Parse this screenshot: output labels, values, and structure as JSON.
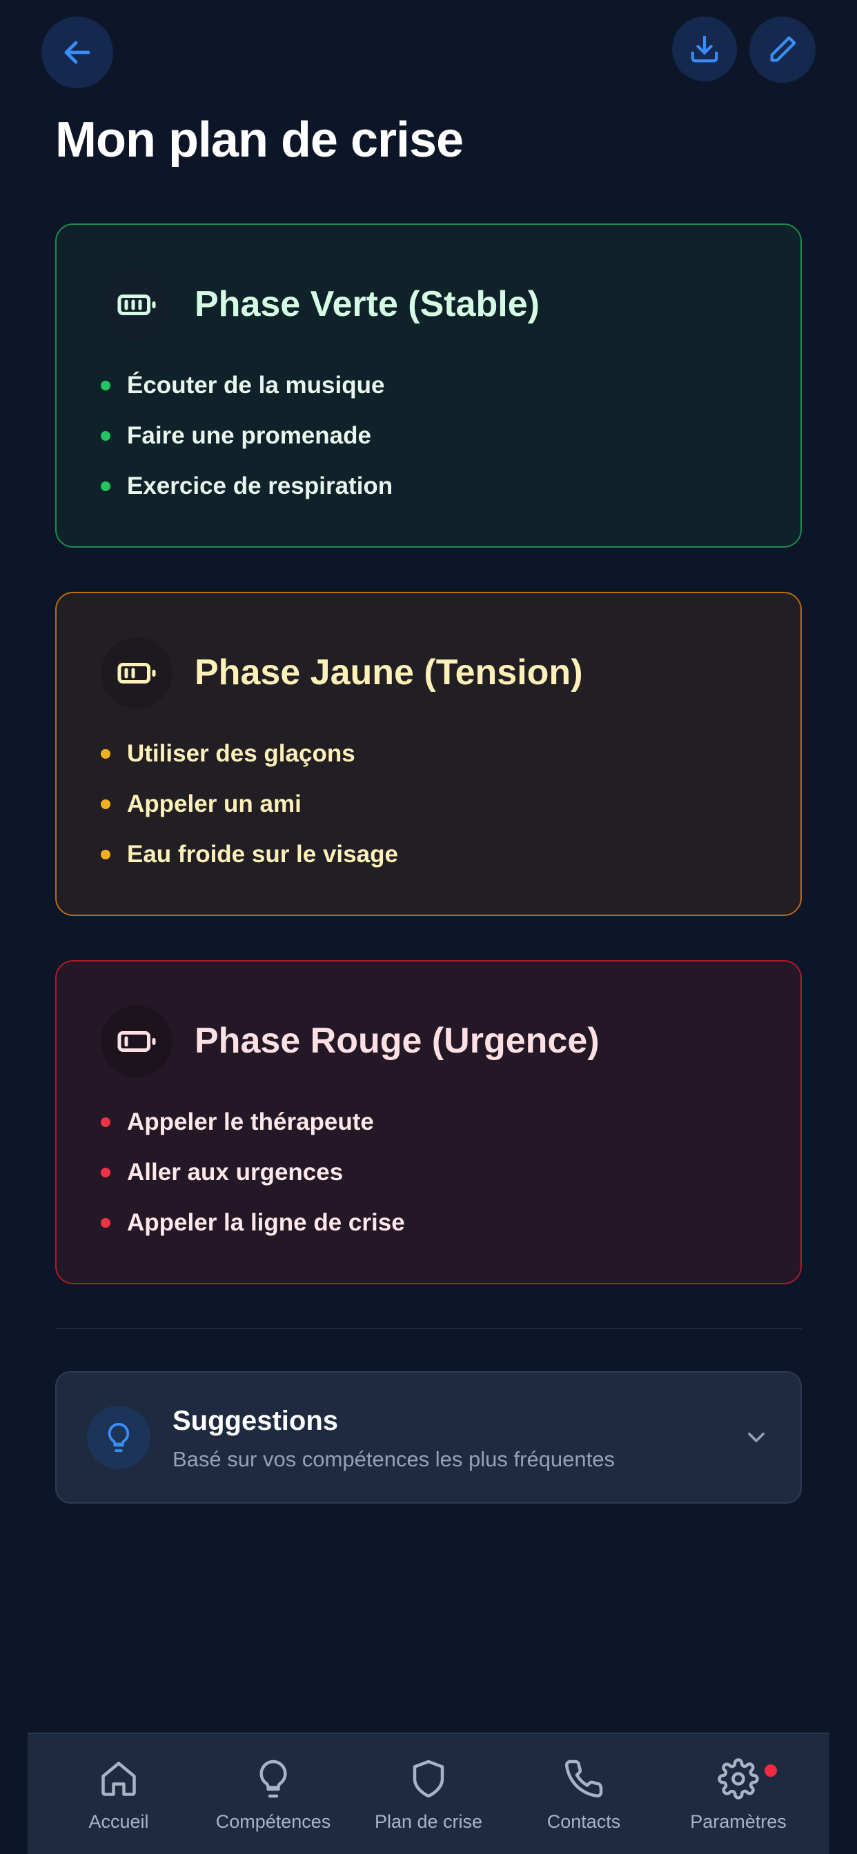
{
  "header": {
    "title": "Mon plan de crise"
  },
  "phases": [
    {
      "title": "Phase Verte (Stable)",
      "icon": "battery-full-icon",
      "color": "#22c55e",
      "items": [
        "Écouter de la musique",
        "Faire une promenade",
        "Exercice de respiration"
      ]
    },
    {
      "title": "Phase Jaune (Tension)",
      "icon": "battery-medium-icon",
      "color": "#f0b020",
      "items": [
        "Utiliser des glaçons",
        "Appeler un ami",
        "Eau froide sur le visage"
      ]
    },
    {
      "title": "Phase Rouge (Urgence)",
      "icon": "battery-low-icon",
      "color": "#ef3344",
      "items": [
        "Appeler le thérapeute",
        "Aller aux urgences",
        "Appeler la ligne de crise"
      ]
    }
  ],
  "suggestions": {
    "title": "Suggestions",
    "subtitle": "Basé sur vos compétences les plus fréquentes",
    "icon": "lightbulb-icon"
  },
  "nav": {
    "items": [
      {
        "label": "Accueil",
        "icon": "home-icon"
      },
      {
        "label": "Compétences",
        "icon": "lightbulb-icon"
      },
      {
        "label": "Plan de crise",
        "icon": "shield-icon"
      },
      {
        "label": "Contacts",
        "icon": "phone-icon"
      },
      {
        "label": "Paramètres",
        "icon": "gear-icon"
      }
    ]
  },
  "colors": {
    "background": "#0d1628",
    "accent": "#3b82f6",
    "notification_dot": "#ef2b3d"
  }
}
